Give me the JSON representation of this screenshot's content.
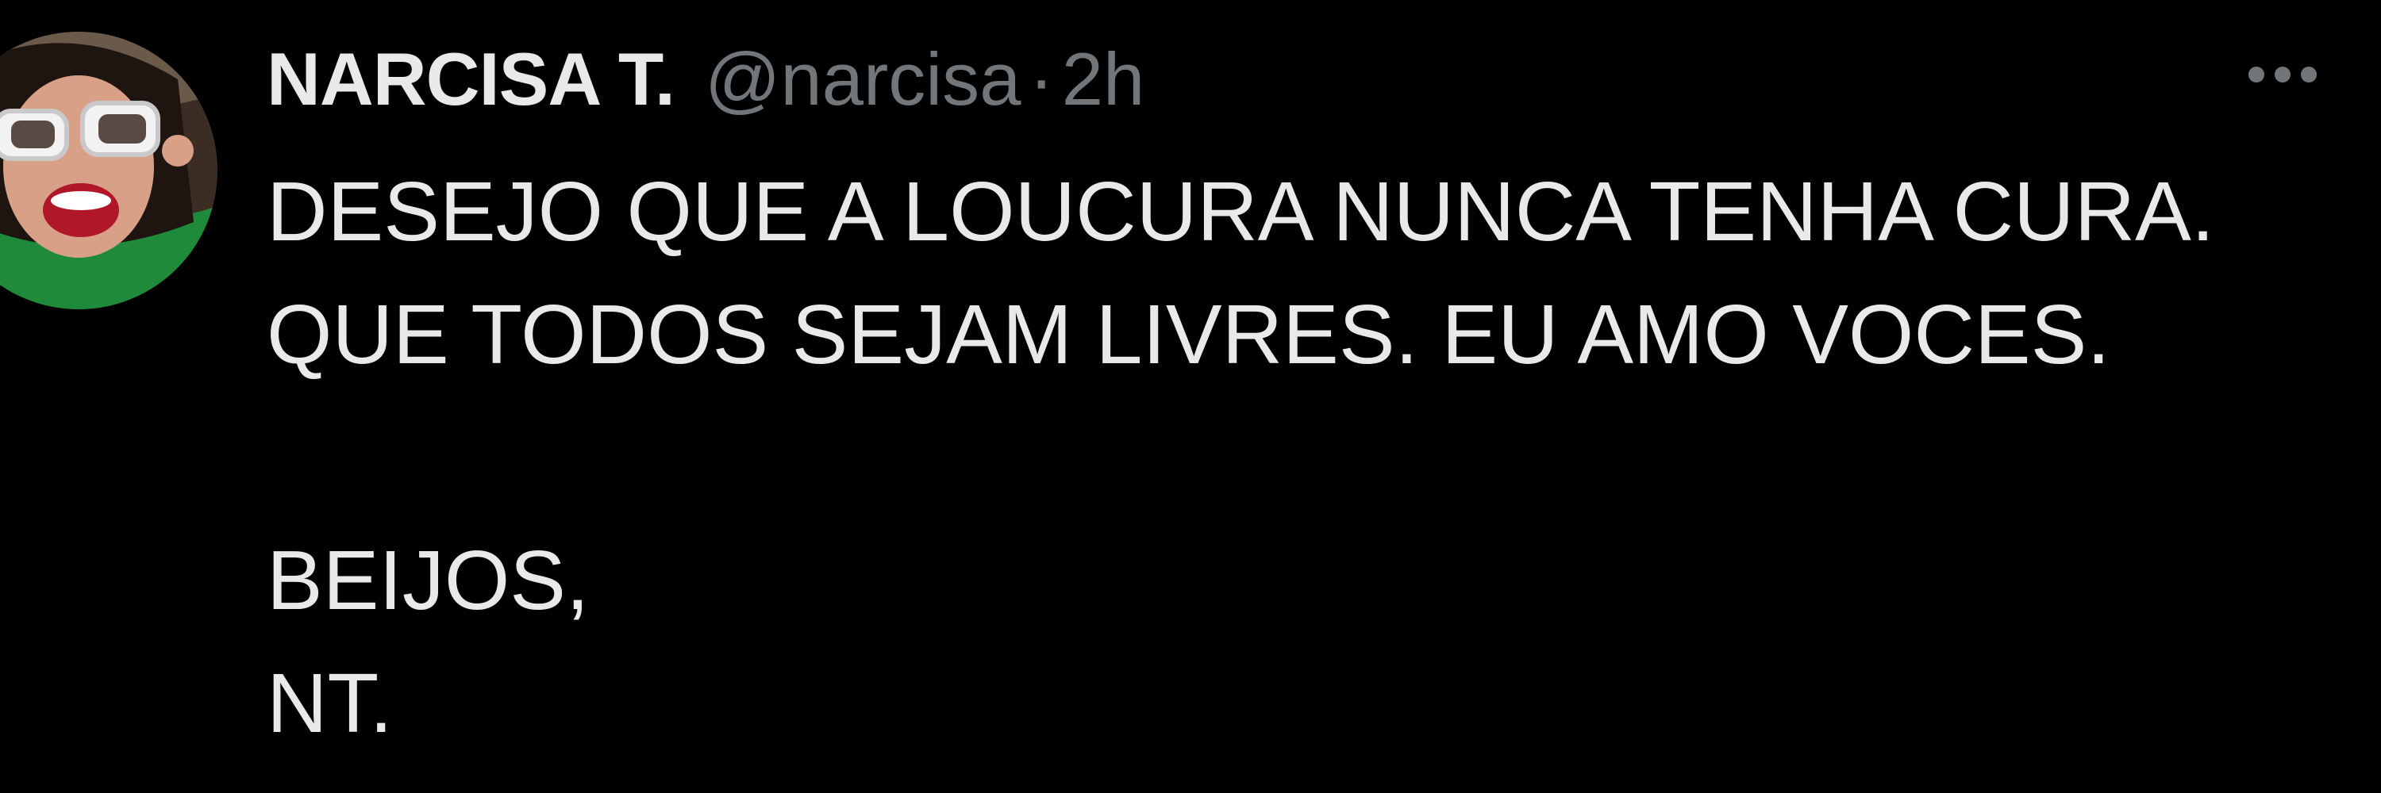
{
  "tweet": {
    "author": {
      "display_name": "NARCISA T.",
      "handle": "@narcisa",
      "avatar_icon": "profile-photo-avatar"
    },
    "separator": "·",
    "timestamp": "2h",
    "more_icon": "more-options-icon",
    "text_lines": [
      "DESEJO QUE A LOUCURA NUNCA TENHA CURA.",
      "QUE TODOS SEJAM LIVRES. EU AMO VOCES.",
      "",
      "BEIJOS,",
      "NT."
    ]
  },
  "colors": {
    "background": "#000000",
    "primary_text": "#e7e9ea",
    "secondary_text": "#71767b"
  }
}
